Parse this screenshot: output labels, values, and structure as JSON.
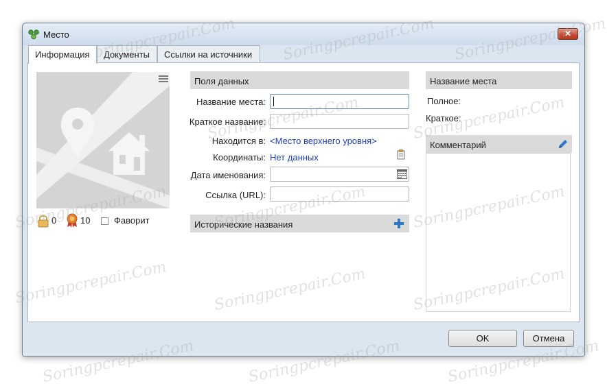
{
  "window": {
    "title": "Место"
  },
  "tabs": [
    {
      "label": "Информация",
      "active": true
    },
    {
      "label": "Документы",
      "active": false
    },
    {
      "label": "Ссылки на источники",
      "active": false
    }
  ],
  "stats": {
    "private_count": "0",
    "citations_count": "10",
    "favorite_label": "Фаворит",
    "favorite_checked": false
  },
  "data_fields": {
    "header": "Поля данных",
    "place_name_label": "Название места:",
    "place_name_value": "",
    "short_name_label": "Краткое название:",
    "short_name_value": "",
    "located_in_label": "Находится в:",
    "located_in_value": "<Место верхнего уровня>",
    "coordinates_label": "Координаты:",
    "coordinates_value": "Нет данных",
    "naming_date_label": "Дата именования:",
    "naming_date_value": "",
    "url_label": "Ссылка (URL):",
    "url_value": ""
  },
  "historical_names": {
    "header": "Исторические названия"
  },
  "place_name_panel": {
    "header": "Название места",
    "full_label": "Полное:",
    "short_label": "Краткое:"
  },
  "comment_panel": {
    "header": "Комментарий"
  },
  "buttons": {
    "ok": "OK",
    "cancel": "Отмена"
  },
  "icons": {
    "app": "place-icon",
    "close": "close-icon",
    "menu": "menu-icon",
    "lock": "lock-icon",
    "award": "award-icon",
    "plus": "plus-icon",
    "pencil": "pencil-icon",
    "calendar": "calendar-icon",
    "clipboard": "clipboard-icon"
  },
  "colors": {
    "link": "#1c3fbf",
    "accent": "#2f76c8",
    "close": "#c84a32",
    "header_bg": "#dadada"
  },
  "watermark": "Soringpcrepair.Com"
}
